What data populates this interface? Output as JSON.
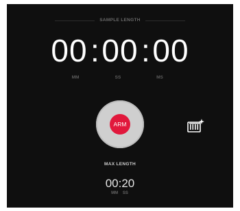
{
  "sample_length": {
    "label": "SAMPLE LENGTH",
    "minutes": "00",
    "seconds": "00",
    "milliseconds": "00",
    "separator": ":",
    "units": {
      "mm": "MM",
      "ss": "SS",
      "ms": "MS"
    }
  },
  "arm_button": {
    "label": "ARM",
    "accent_color": "#e1183c"
  },
  "settings": {
    "icon": "keyboard-sparkle-icon"
  },
  "max_length": {
    "label": "MAX LENGTH",
    "value": "00:20",
    "units": {
      "mm": "MM",
      "ss": "SS"
    }
  }
}
